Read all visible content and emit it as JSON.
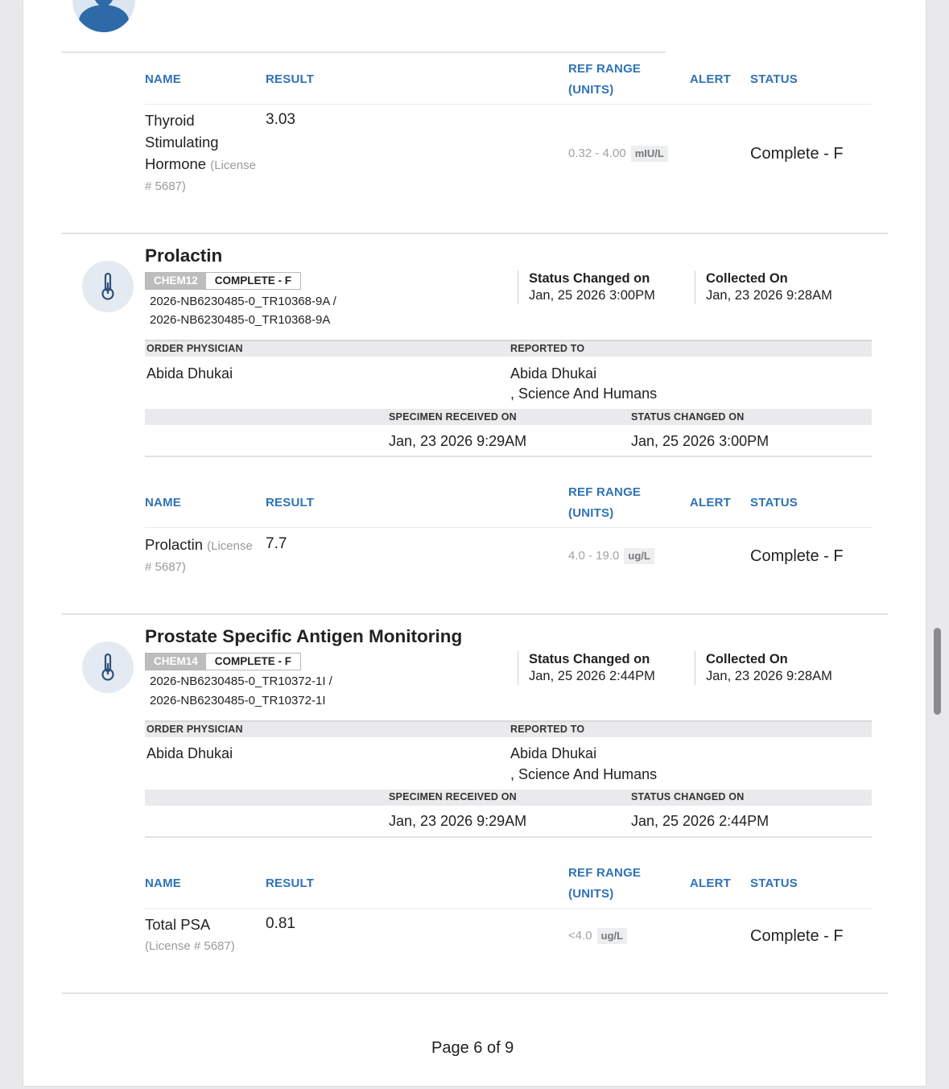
{
  "headers": {
    "name": "NAME",
    "result": "RESULT",
    "ref_range_1": "REF RANGE",
    "ref_range_2": "(UNITS)",
    "alert": "ALERT",
    "status": "STATUS"
  },
  "tsh": {
    "name_1": "Thyroid",
    "name_2": "Stimulating",
    "name_3": "Hormone",
    "license_1": "(License",
    "license_2": "# 5687)",
    "result": "3.03",
    "range": "0.32 - 4.00",
    "unit": "mIU/L",
    "status": "Complete - F"
  },
  "labels": {
    "status_changed_on": "Status Changed on",
    "collected_on": "Collected On",
    "order_physician": "ORDER PHYSICIAN",
    "reported_to": "REPORTED TO",
    "specimen_received_on": "SPECIMEN RECEIVED ON",
    "status_changed_on_caps": "STATUS CHANGED ON"
  },
  "prolactin": {
    "title": "Prolactin",
    "code": "CHEM12",
    "badge_status": "COMPLETE - F",
    "accession_1": "2026-NB6230485-0_TR10368-9A /",
    "accession_2": "2026-NB6230485-0_TR10368-9A",
    "status_changed": "Jan, 25 2026 3:00PM",
    "collected": "Jan, 23 2026 9:28AM",
    "order_physician": "Abida Dhukai",
    "reported_to_1": "Abida Dhukai",
    "reported_to_2": ", Science And Humans",
    "specimen_received": "Jan, 23 2026 9:29AM",
    "status_changed_2": "Jan, 25 2026 3:00PM",
    "result_name": "Prolactin",
    "license_1": "(License",
    "license_2": "# 5687)",
    "result": "7.7",
    "range": "4.0 - 19.0",
    "unit": "ug/L",
    "status": "Complete - F"
  },
  "psa": {
    "title": "Prostate Specific Antigen Monitoring",
    "code": "CHEM14",
    "badge_status": "COMPLETE - F",
    "accession_1": "2026-NB6230485-0_TR10372-1I /",
    "accession_2": "2026-NB6230485-0_TR10372-1I",
    "status_changed": "Jan, 25 2026 2:44PM",
    "collected": "Jan, 23 2026 9:28AM",
    "order_physician": "Abida Dhukai",
    "reported_to_1": "Abida Dhukai",
    "reported_to_2": ", Science And Humans",
    "specimen_received": "Jan, 23 2026 9:29AM",
    "status_changed_2": "Jan, 25 2026 2:44PM",
    "result_name": "Total PSA",
    "license": "(License # 5687)",
    "result": "0.81",
    "range": "<4.0",
    "unit": "ug/L",
    "status": "Complete - F"
  },
  "footer": {
    "page": "Page 6 of 9"
  }
}
